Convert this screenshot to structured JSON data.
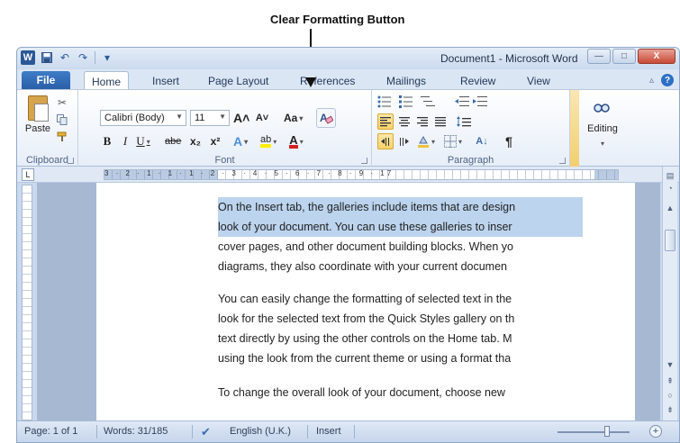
{
  "annotation": {
    "label": "Clear Formatting Button"
  },
  "window": {
    "title": "Document1 - Microsoft Word",
    "app_icon_letter": "W",
    "controls": {
      "minimize": "—",
      "maximize": "□",
      "close": "X"
    }
  },
  "quick_access": {
    "undo": "↶",
    "redo": "↷"
  },
  "tabs": {
    "file": "File",
    "items": [
      "Home",
      "Insert",
      "Page Layout",
      "References",
      "Mailings",
      "Review",
      "View"
    ],
    "active": "Home"
  },
  "ribbon": {
    "clipboard": {
      "paste_label": "Paste",
      "group_label": "Clipboard"
    },
    "font": {
      "font_name": "Calibri (Body)",
      "font_size": "11",
      "grow": "A˄",
      "shrink": "A˅",
      "change_case": "Aa",
      "clear_formatting_glyph": "A",
      "bold": "B",
      "italic": "I",
      "underline": "U",
      "strikethrough": "abe",
      "subscript": "x₂",
      "superscript": "x²",
      "text_effects": "A",
      "highlight": "ab",
      "font_color": "A",
      "group_label": "Font"
    },
    "paragraph": {
      "group_label": "Paragraph",
      "sort": "A↓",
      "pilcrow": "¶"
    },
    "styles": {},
    "editing": {
      "label": "Editing"
    }
  },
  "ruler": {
    "numbers": "3 · 2 · 1 · 1 · 1 · 2 · 3 · 4 · 5 · 6 · 7 · 8 · 9 · 17"
  },
  "document": {
    "paragraphs": [
      {
        "lines": [
          {
            "text": "On the Insert tab, the galleries include items that are design",
            "highlighted": true
          },
          {
            "text": "look of your document. You can use these galleries to inser",
            "highlighted": true
          },
          {
            "text": "cover pages, and other document building blocks. When yo",
            "highlighted": false
          },
          {
            "text": "diagrams, they also coordinate with your current documen",
            "highlighted": false
          }
        ]
      },
      {
        "lines": [
          {
            "text": "You can easily change the formatting of selected text in the",
            "highlighted": false
          },
          {
            "text": "look for the selected text from the Quick Styles gallery on th",
            "highlighted": false
          },
          {
            "text": "text directly by using the other controls on the Home tab. M",
            "highlighted": false
          },
          {
            "text": "using the look from the current theme or using a format tha",
            "highlighted": false
          }
        ]
      },
      {
        "lines": [
          {
            "text": "To change the overall look of your document, choose new",
            "highlighted": false
          }
        ]
      }
    ]
  },
  "statusbar": {
    "page": "Page: 1 of 1",
    "words": "Words: 31/185",
    "language": "English (U.K.)",
    "mode": "Insert",
    "zoom_plus": "+"
  },
  "colors": {
    "selection": "#bcd4ee",
    "file_tab": "#2a5fa8",
    "highlight_yellow": "#ffee00",
    "font_red": "#d42020"
  }
}
